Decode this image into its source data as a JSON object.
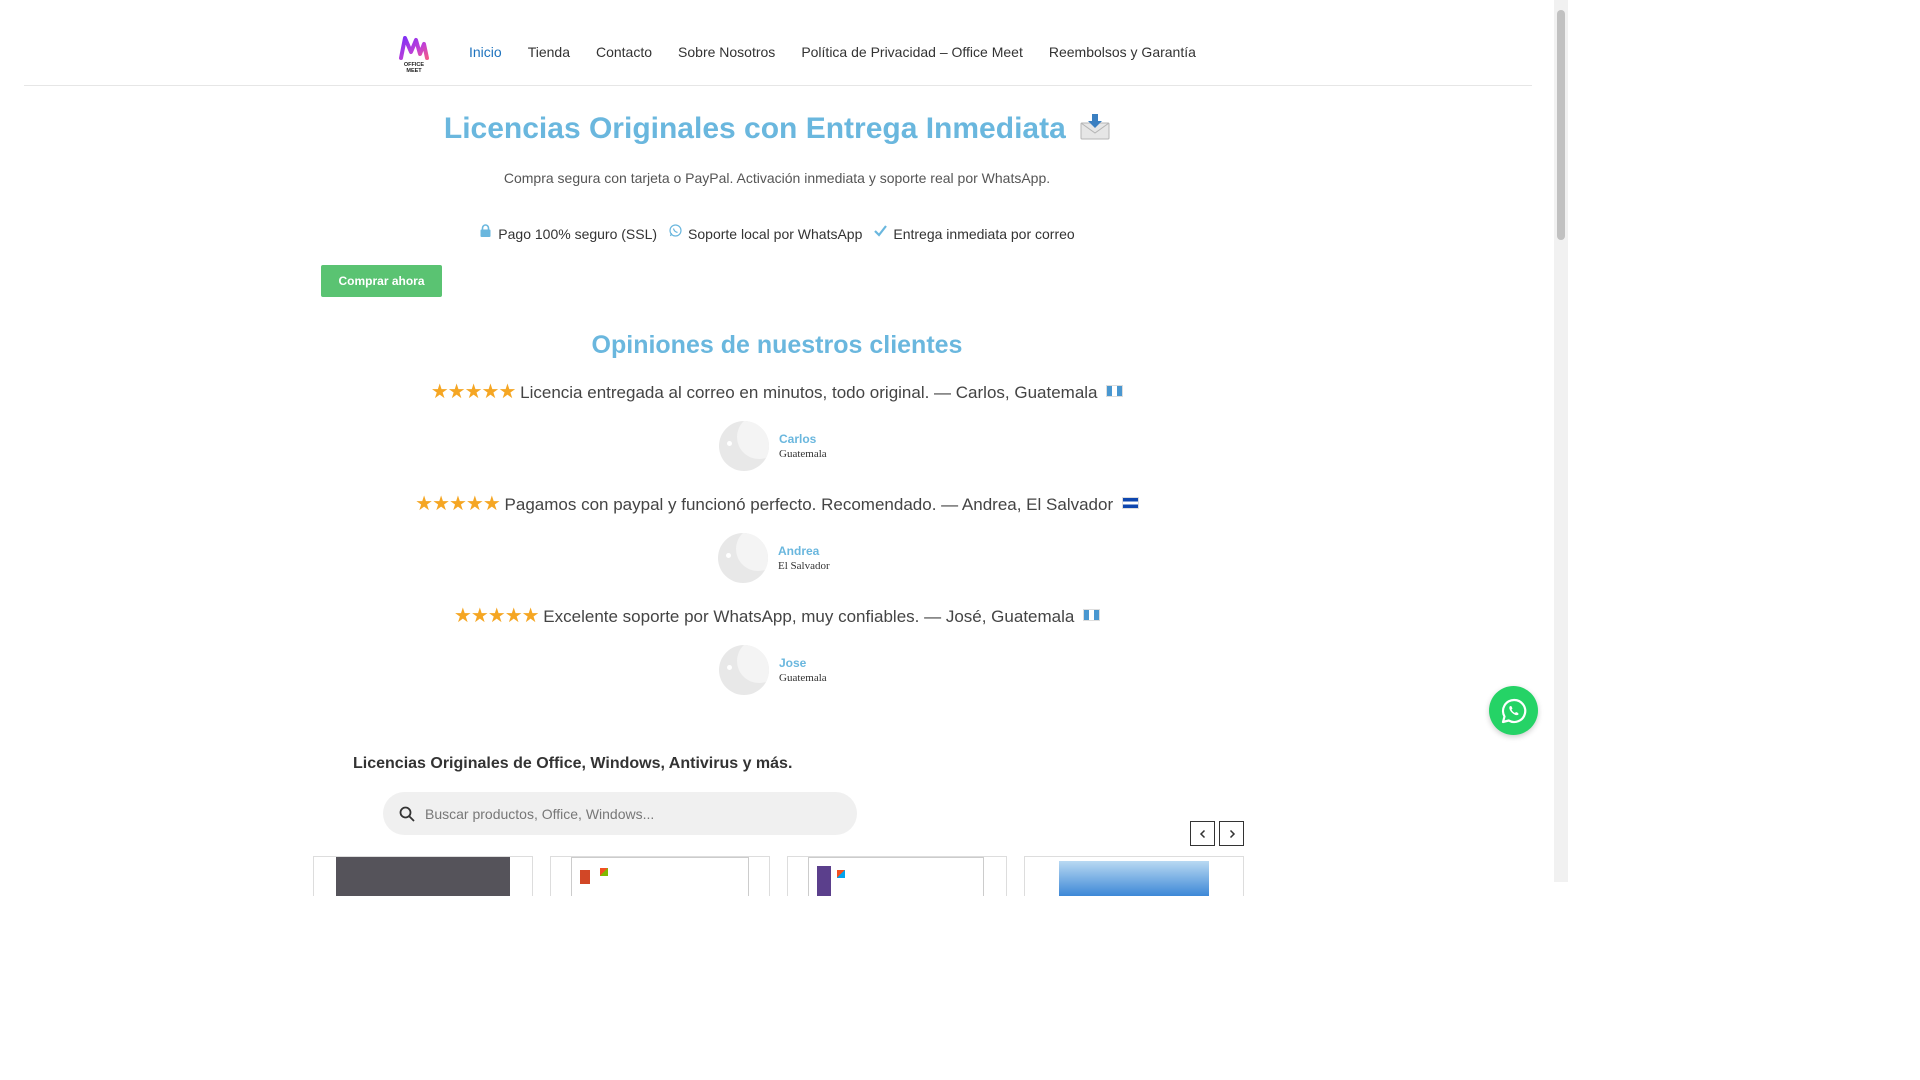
{
  "header": {
    "logo_text": "OFFICE MEET",
    "nav": [
      {
        "label": "Inicio",
        "active": true
      },
      {
        "label": "Tienda"
      },
      {
        "label": "Contacto"
      },
      {
        "label": "Sobre Nosotros"
      },
      {
        "label": "Política de Privacidad – Office Meet"
      },
      {
        "label": "Reembolsos y Garantía"
      }
    ]
  },
  "hero": {
    "title": "Licencias Originales con Entrega Inmediata",
    "title_icon": "incoming-envelope-icon",
    "subtitle": "Compra segura con tarjeta o PayPal. Activación inmediata y soporte real por WhatsApp.",
    "badges": [
      {
        "icon": "lock-icon",
        "label": "Pago 100% seguro (SSL)"
      },
      {
        "icon": "whatsapp-icon",
        "label": "Soporte local por WhatsApp"
      },
      {
        "icon": "check-icon",
        "label": "Entrega inmediata por correo"
      }
    ],
    "cta": "Comprar ahora"
  },
  "reviews": {
    "title": "Opiniones de nuestros clientes",
    "items": [
      {
        "stars": "★★★★★",
        "rating": 5,
        "text": "Licencia entregada al correo en minutos, todo original. — Carlos, Guatemala",
        "flag": "guatemala-flag",
        "name": "Carlos",
        "country": "Guatemala"
      },
      {
        "stars": "★★★★★",
        "rating": 5,
        "text": "Pagamos con paypal y funcionó perfecto. Recomendado. — Andrea, El Salvador",
        "flag": "el-salvador-flag",
        "name": "Andrea",
        "country": "El Salvador"
      },
      {
        "stars": "★★★★★",
        "rating": 5,
        "text": "Excelente soporte por WhatsApp, muy confiables. — José, Guatemala",
        "flag": "guatemala-flag",
        "name": "Jose",
        "country": "Guatemala"
      }
    ]
  },
  "products": {
    "heading": "Licencias Originales de Office, Windows, Antivirus y más.",
    "search_placeholder": "Buscar productos, Office, Windows...",
    "search_value": ""
  },
  "colors": {
    "accent": "#6ab7de",
    "nav_active": "#1e73be",
    "cta": "#5ac372",
    "whatsapp": "#25d366",
    "stars": "#f5a623"
  }
}
